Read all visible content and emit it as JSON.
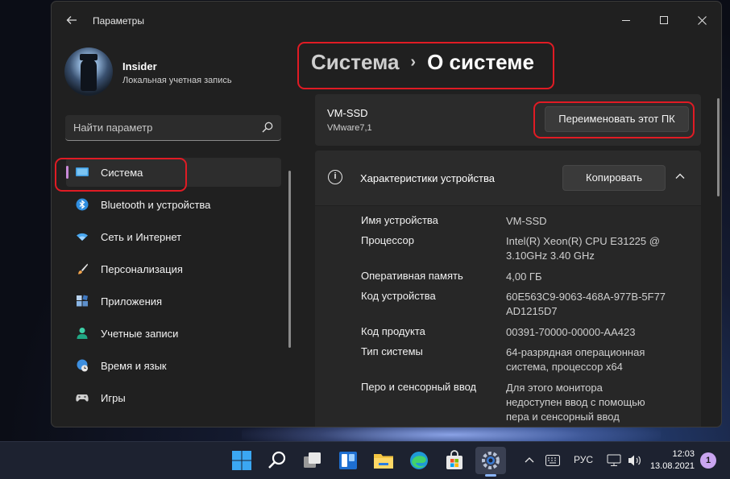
{
  "window": {
    "title": "Параметры",
    "back_icon": "arrow-left-icon",
    "controls": [
      "minimize-icon",
      "maximize-icon",
      "close-icon"
    ]
  },
  "profile": {
    "name": "Insider",
    "account_type": "Локальная учетная запись"
  },
  "search": {
    "placeholder": "Найти параметр",
    "icon": "search-icon"
  },
  "sidebar": {
    "items": [
      {
        "label": "Система",
        "icon": "monitor-icon",
        "active": true
      },
      {
        "label": "Bluetooth и устройства",
        "icon": "bluetooth-icon"
      },
      {
        "label": "Сеть и Интернет",
        "icon": "wifi-icon"
      },
      {
        "label": "Персонализация",
        "icon": "brush-icon"
      },
      {
        "label": "Приложения",
        "icon": "apps-icon"
      },
      {
        "label": "Учетные записи",
        "icon": "person-icon"
      },
      {
        "label": "Время и язык",
        "icon": "globe-clock-icon"
      },
      {
        "label": "Игры",
        "icon": "gamepad-icon"
      }
    ]
  },
  "breadcrumb": {
    "parent": "Система",
    "separator": "›",
    "current": "О системе"
  },
  "pc": {
    "name": "VM-SSD",
    "model": "VMware7,1",
    "rename_label": "Переименовать этот ПК"
  },
  "specs": {
    "title": "Характеристики устройства",
    "copy_label": "Копировать",
    "rows": [
      {
        "key": "Имя устройства",
        "value": "VM-SSD"
      },
      {
        "key": "Процессор",
        "value": "Intel(R) Xeon(R) CPU E31225 @ 3.10GHz   3.40 GHz"
      },
      {
        "key": "Оперативная память",
        "value": "4,00 ГБ"
      },
      {
        "key": "Код устройства",
        "value": "60E563C9-9063-468A-977B-5F77AD1215D7"
      },
      {
        "key": "Код продукта",
        "value": "00391-70000-00000-AA423"
      },
      {
        "key": "Тип системы",
        "value": "64-разрядная операционная система, процессор x64"
      },
      {
        "key": "Перо и сенсорный ввод",
        "value": "Для этого монитора недоступен ввод с помощью пера и сенсорный ввод"
      }
    ]
  },
  "taskbar": {
    "apps": [
      "windows-start-icon",
      "search-icon",
      "task-view-icon",
      "widgets-icon",
      "file-explorer-icon",
      "edge-icon",
      "store-icon",
      "settings-icon"
    ],
    "language": "РУС",
    "time": "12:03",
    "date": "13.08.2021",
    "notifications": "1"
  },
  "colors": {
    "accent": "#c88ad8",
    "highlight": "#e01b24",
    "window_bg": "#202020",
    "card_bg": "#2b2b2b"
  }
}
